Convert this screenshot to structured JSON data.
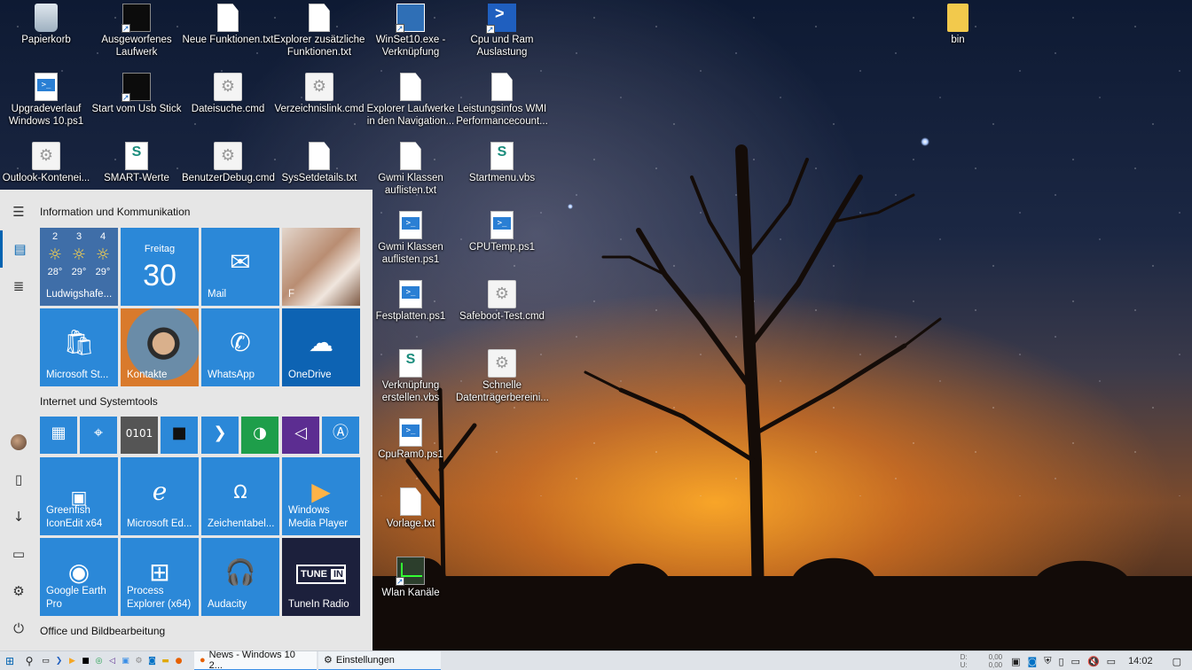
{
  "desktop": {
    "icons": [
      {
        "label": "Papierkorb",
        "kind": "recycle"
      },
      {
        "label": "Ausgeworfenes\nLaufwerk",
        "kind": "term"
      },
      {
        "label": "Neue Funktionen.txt",
        "kind": "doc"
      },
      {
        "label": "Explorer zusätzliche\nFunktionen.txt",
        "kind": "doc"
      },
      {
        "label": "WinSet10.exe -\nVerknüpfung",
        "kind": "winset"
      },
      {
        "label": "Cpu und Ram\nAuslastung",
        "kind": "cpu"
      },
      {
        "label": "bin",
        "kind": "folder"
      },
      {
        "label": "Upgradeverlauf\nWindows 10.ps1",
        "kind": "ps"
      },
      {
        "label": "Start vom Usb Stick",
        "kind": "term"
      },
      {
        "label": "Dateisuche.cmd",
        "kind": "gear"
      },
      {
        "label": "Verzeichnislink.cmd",
        "kind": "gear"
      },
      {
        "label": "Explorer Laufwerke\nin den Navigation...",
        "kind": "doc"
      },
      {
        "label": "Leistungsinfos WMI\nPerformancecount...",
        "kind": "doc"
      },
      {
        "label": "Outlook-Kontenei...",
        "kind": "gear"
      },
      {
        "label": "SMART-Werte",
        "kind": "vbs"
      },
      {
        "label": "BenutzerDebug.cmd",
        "kind": "gear"
      },
      {
        "label": "SysSetdetails.txt",
        "kind": "doc"
      },
      {
        "label": "Gwmi Klassen\nauflisten.txt",
        "kind": "doc"
      },
      {
        "label": "Startmenu.vbs",
        "kind": "vbs"
      },
      {
        "label": "Gwmi Klassen\nauflisten.ps1",
        "kind": "ps"
      },
      {
        "label": "CPUTemp.ps1",
        "kind": "ps"
      },
      {
        "label": "Festplatten.ps1",
        "kind": "ps"
      },
      {
        "label": "Safeboot-Test.cmd",
        "kind": "gear"
      },
      {
        "label": "Verknüpfung\nerstellen.vbs",
        "kind": "vbs"
      },
      {
        "label": "Schnelle\nDatenträgerbereini...",
        "kind": "gear"
      },
      {
        "label": "CpuRam0.ps1",
        "kind": "ps"
      },
      {
        "label": "Vorlage.txt",
        "kind": "doc"
      },
      {
        "label": "Wlan Kanäle",
        "kind": "wlan"
      }
    ]
  },
  "start_menu": {
    "group1_title": "Information und Kommunikation",
    "group2_title": "Internet und Systemtools",
    "group3_title": "Office und Bildbearbeitung",
    "weather": {
      "location": "Ludwigshafe...",
      "days": [
        "2",
        "3",
        "4"
      ],
      "temps": [
        "28°",
        "29°",
        "29°"
      ]
    },
    "calendar": {
      "weekday": "Freitag",
      "day": "30"
    },
    "tiles": {
      "mail": "Mail",
      "photos": "F",
      "store": "Microsoft St...",
      "contacts": "Kontakte",
      "whatsapp": "WhatsApp",
      "onedrive": "OneDrive",
      "greenfish": "Greenfish\nIconEdit x64",
      "edge": "Microsoft Ed...",
      "charmap": "Zeichentabel...",
      "wmp": "Windows\nMedia Player",
      "google_earth": "Google Earth\nPro",
      "procexp": "Process\nExplorer (x64)",
      "audacity": "Audacity",
      "tunein": "TuneIn Radio"
    }
  },
  "taskbar": {
    "tasks": [
      "News - Windows 10 2...",
      "Einstellungen"
    ],
    "netstat": [
      "D:",
      "U:",
      "0,00",
      "0,00"
    ],
    "clock": "14:02"
  }
}
